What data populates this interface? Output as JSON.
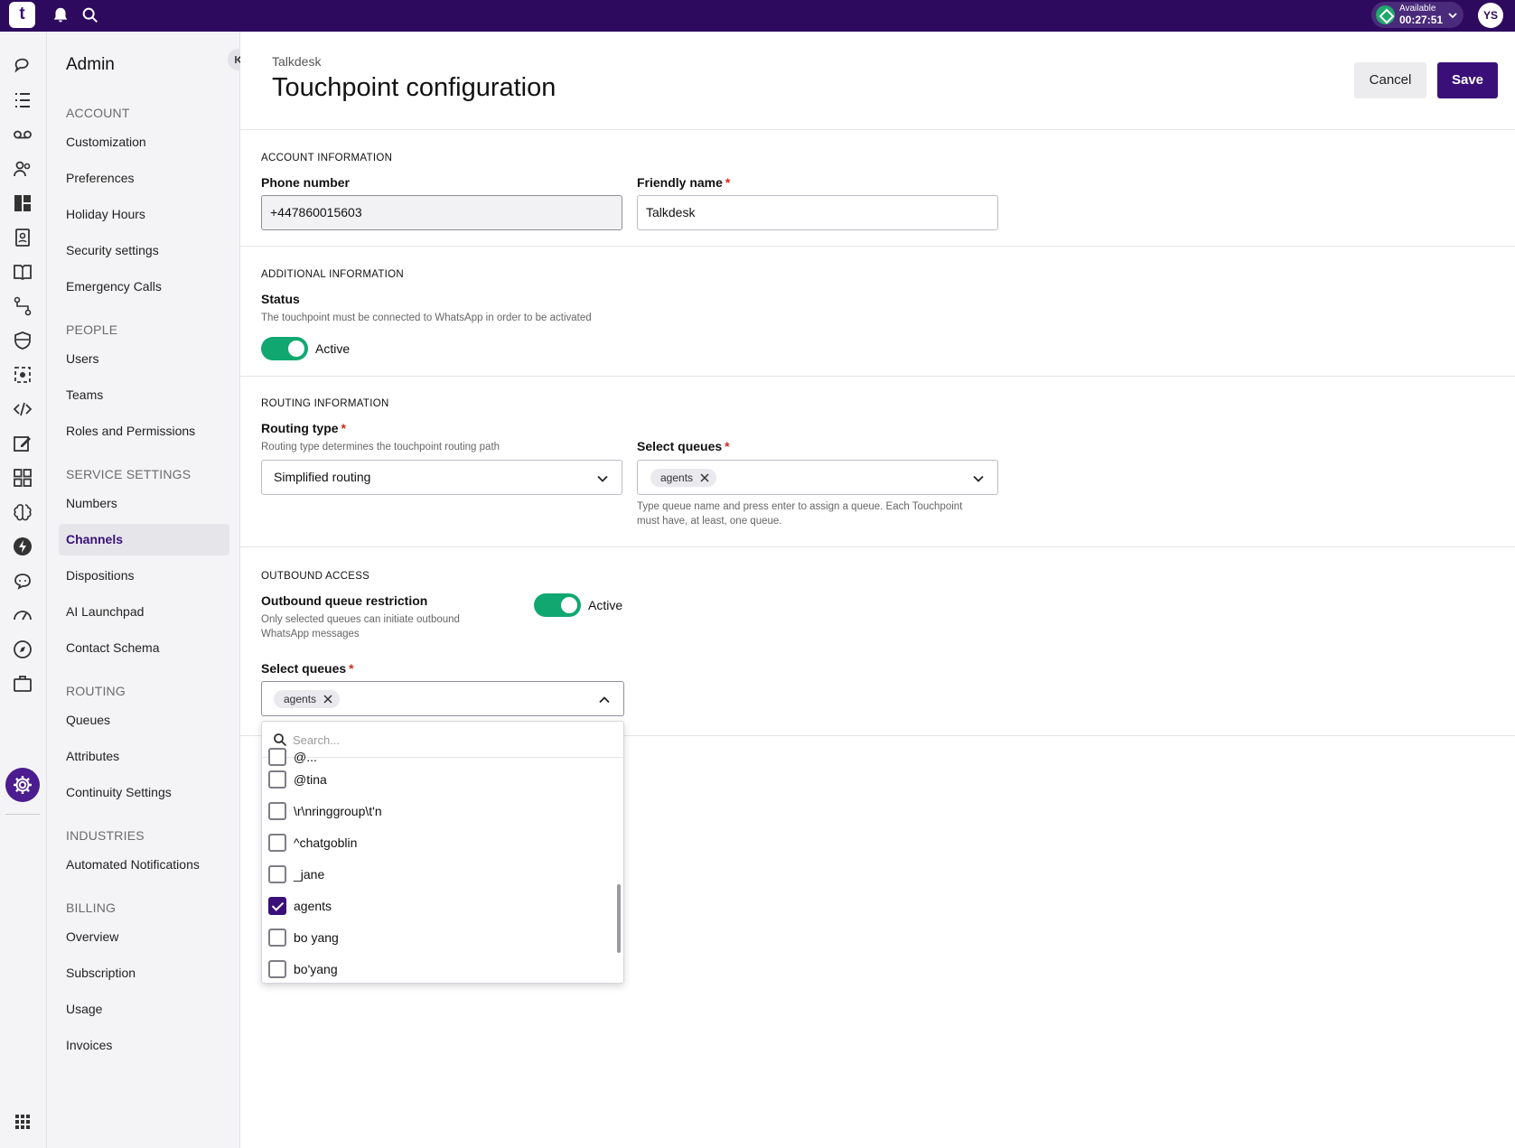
{
  "topbar": {
    "logo_text": "t",
    "status_label": "Available",
    "status_timer": "00:27:51",
    "avatar_initials": "YS"
  },
  "sidebar": {
    "title": "Admin",
    "sections": [
      {
        "heading": "ACCOUNT",
        "items": [
          "Customization",
          "Preferences",
          "Holiday Hours",
          "Security settings",
          "Emergency Calls"
        ]
      },
      {
        "heading": "PEOPLE",
        "items": [
          "Users",
          "Teams",
          "Roles and Permissions"
        ]
      },
      {
        "heading": "SERVICE SETTINGS",
        "items": [
          "Numbers",
          "Channels",
          "Dispositions",
          "AI Launchpad",
          "Contact Schema"
        ]
      },
      {
        "heading": "ROUTING",
        "items": [
          "Queues",
          "Attributes",
          "Continuity Settings"
        ]
      },
      {
        "heading": "INDUSTRIES",
        "items": [
          "Automated Notifications"
        ]
      },
      {
        "heading": "BILLING",
        "items": [
          "Overview",
          "Subscription",
          "Usage",
          "Invoices"
        ]
      }
    ],
    "active_item": "Channels"
  },
  "header": {
    "breadcrumb": "Talkdesk",
    "title": "Touchpoint configuration",
    "cancel_label": "Cancel",
    "save_label": "Save"
  },
  "account_info": {
    "heading": "ACCOUNT INFORMATION",
    "phone_label": "Phone number",
    "phone_value": "+447860015603",
    "friendly_label": "Friendly name",
    "friendly_value": "Talkdesk"
  },
  "additional_info": {
    "heading": "ADDITIONAL INFORMATION",
    "status_label": "Status",
    "status_help": "The touchpoint must be connected to WhatsApp in order to be activated",
    "status_toggle_label": "Active"
  },
  "routing_info": {
    "heading": "ROUTING INFORMATION",
    "routing_type_label": "Routing type",
    "routing_type_help": "Routing type determines the touchpoint routing path",
    "routing_type_value": "Simplified routing",
    "select_queues_label": "Select queues",
    "queue_chip": "agents",
    "queues_help_1": "Type queue name and press enter to assign a queue. Each Touchpoint",
    "queues_help_2": "must have, at least, one queue."
  },
  "outbound_access": {
    "heading": "OUTBOUND ACCESS",
    "restriction_label": "Outbound queue restriction",
    "restriction_help_1": "Only selected queues can initiate outbound",
    "restriction_help_2": "WhatsApp messages",
    "toggle_label": "Active",
    "select_queues_label": "Select queues",
    "queue_chip": "agents"
  },
  "dropdown": {
    "search_placeholder": "Search...",
    "options": [
      {
        "label": "@...",
        "checked": false
      },
      {
        "label": "@tina",
        "checked": false
      },
      {
        "label": "\\r\\nringgroup\\t'n",
        "checked": false
      },
      {
        "label": "^chatgoblin",
        "checked": false
      },
      {
        "label": "_jane",
        "checked": false
      },
      {
        "label": "agents",
        "checked": true
      },
      {
        "label": "bo yang",
        "checked": false
      },
      {
        "label": "bo'yang",
        "checked": false
      }
    ]
  },
  "colors": {
    "brand": "#2d0a5e",
    "primary": "#3a1078",
    "toggle_on": "#10a870",
    "required": "#d9261c"
  }
}
